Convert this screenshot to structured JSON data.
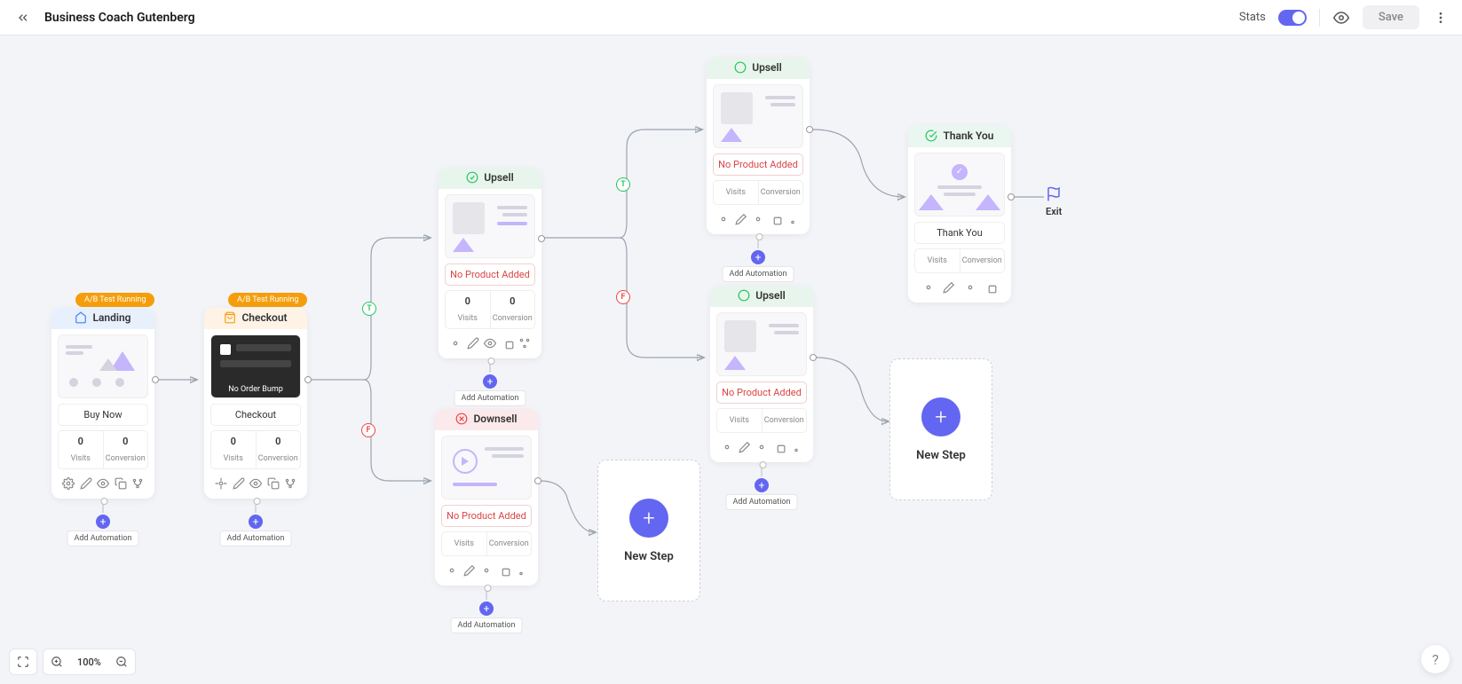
{
  "header": {
    "title": "Business Coach Gutenberg",
    "stats_label": "Stats",
    "save_label": "Save"
  },
  "badges": {
    "ab_running": "A/B Test Running"
  },
  "branch": {
    "t": "T",
    "f": "F"
  },
  "cards": {
    "landing": {
      "title": "Landing",
      "label": "Buy Now",
      "visits_num": "0",
      "visits_lab": "Visits",
      "conv_num": "0",
      "conv_lab": "Conversion",
      "automation": "Add Automation"
    },
    "checkout": {
      "title": "Checkout",
      "label": "Checkout",
      "overlay": "No Order Bump",
      "visits_num": "0",
      "visits_lab": "Visits",
      "conv_num": "0",
      "conv_lab": "Conversion",
      "automation": "Add Automation"
    },
    "upsell1": {
      "title": "Upsell",
      "label": "No Product Added",
      "visits_num": "0",
      "visits_lab": "Visits",
      "conv_num": "0",
      "conv_lab": "Conversion",
      "automation": "Add Automation"
    },
    "downsell": {
      "title": "Downsell",
      "label": "No Product Added",
      "visits_lab": "Visits",
      "conv_lab": "Conversion",
      "automation": "Add Automation"
    },
    "upsell2": {
      "title": "Upsell",
      "label": "No Product Added",
      "visits_lab": "Visits",
      "conv_lab": "Conversion",
      "automation": "Add Automation"
    },
    "upsell3": {
      "title": "Upsell",
      "label": "No Product Added",
      "visits_lab": "Visits",
      "conv_lab": "Conversion",
      "automation": "Add Automation"
    },
    "thankyou": {
      "title": "Thank You",
      "label": "Thank You",
      "visits_lab": "Visits",
      "conv_lab": "Conversion"
    }
  },
  "newstep": {
    "label": "New Step"
  },
  "exit": {
    "label": "Exit"
  },
  "footer": {
    "zoom": "100%"
  }
}
